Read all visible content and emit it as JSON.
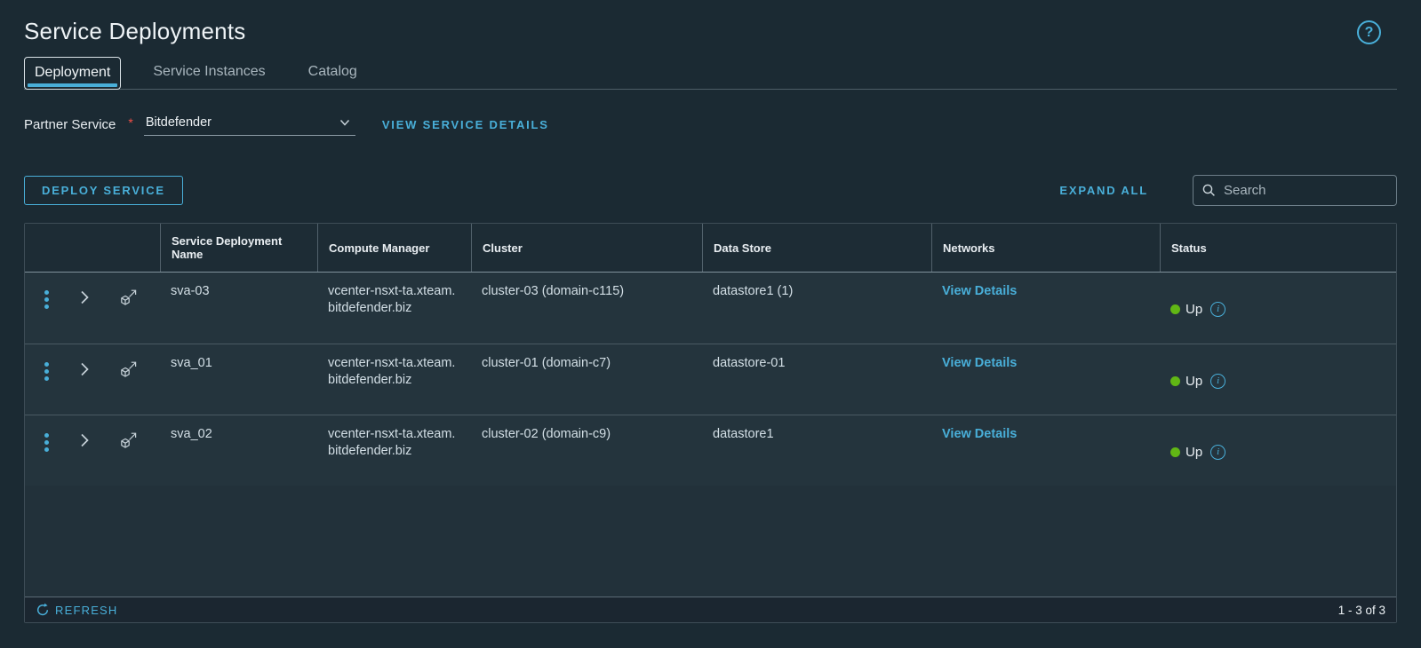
{
  "page": {
    "title": "Service Deployments"
  },
  "header": {
    "help_glyph": "?"
  },
  "tabs": [
    {
      "label": "Deployment",
      "active": true
    },
    {
      "label": "Service Instances",
      "active": false
    },
    {
      "label": "Catalog",
      "active": false
    }
  ],
  "form": {
    "label": "Partner Service",
    "required_marker": "*",
    "selected_service": "Bitdefender",
    "view_details_link": "VIEW SERVICE DETAILS"
  },
  "toolbar": {
    "deploy_button": "DEPLOY SERVICE",
    "expand_all": "EXPAND ALL",
    "search_placeholder": "Search"
  },
  "table": {
    "columns": [
      "",
      "Service Deployment Name",
      "Compute Manager",
      "Cluster",
      "Data Store",
      "Networks",
      "Status"
    ],
    "rows": [
      {
        "name": "sva-03",
        "compute_manager": "vcenter-nsxt-ta.xteam.bitdefender.biz",
        "cluster": "cluster-03 (domain-c115)",
        "data_store": "datastore1 (1)",
        "networks_link": "View Details",
        "status": "Up",
        "info_glyph": "i"
      },
      {
        "name": "sva_01",
        "compute_manager": "vcenter-nsxt-ta.xteam.bitdefender.biz",
        "cluster": "cluster-01 (domain-c7)",
        "data_store": "datastore-01",
        "networks_link": "View Details",
        "status": "Up",
        "info_glyph": "i"
      },
      {
        "name": "sva_02",
        "compute_manager": "vcenter-nsxt-ta.xteam.bitdefender.biz",
        "cluster": "cluster-02 (domain-c9)",
        "data_store": "datastore1",
        "networks_link": "View Details",
        "status": "Up",
        "info_glyph": "i"
      }
    ],
    "footer": {
      "refresh_label": "REFRESH",
      "pagination": "1 - 3 of 3"
    }
  },
  "colors": {
    "accent": "#49afd9",
    "status_up": "#61b715",
    "required": "#f54f47",
    "background": "#1b2a33",
    "row_background": "#24343d"
  }
}
